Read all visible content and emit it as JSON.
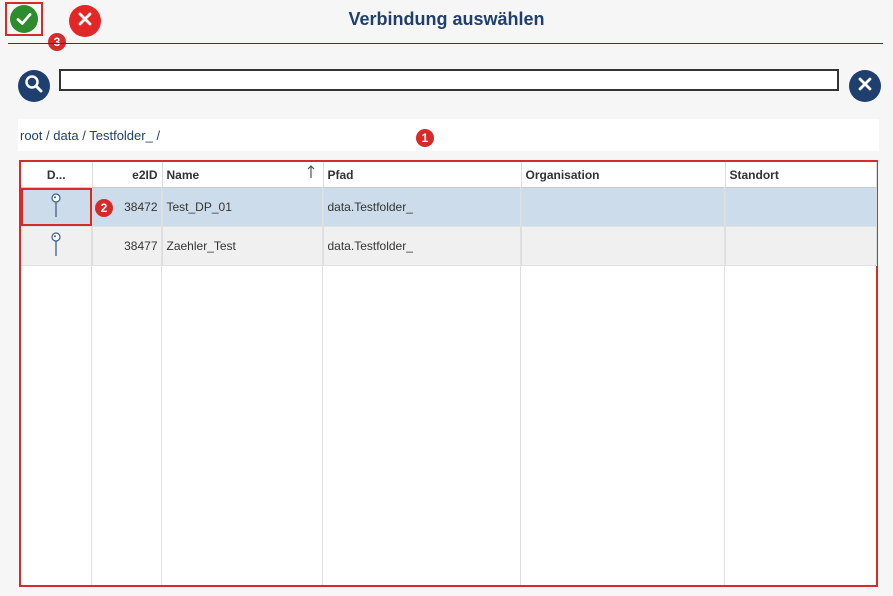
{
  "header": {
    "title": "Verbindung auswählen"
  },
  "badges": {
    "b1": "1",
    "b2": "2",
    "b3": "3"
  },
  "breadcrumb": {
    "items": [
      "root",
      "data",
      "Testfolder_"
    ],
    "separator": "/"
  },
  "search": {
    "value": "",
    "placeholder": ""
  },
  "table": {
    "columns": [
      "D...",
      "e2ID",
      "Name",
      "Pfad",
      "Organisation",
      "Standort"
    ],
    "sort_column": "Name",
    "rows": [
      {
        "e2id": "38472",
        "name": "Test_DP_01",
        "pfad": "data.Testfolder_",
        "organisation": "",
        "standort": "",
        "selected": true
      },
      {
        "e2id": "38477",
        "name": "Zaehler_Test",
        "pfad": "data.Testfolder_",
        "organisation": "",
        "standort": "",
        "selected": false
      }
    ]
  },
  "icons": {
    "ok": "checkmark-icon",
    "cancel": "close-icon",
    "search": "search-icon",
    "clear": "clear-icon",
    "row": "pin-icon"
  },
  "colors": {
    "accent": "#1f3f6e",
    "ok": "#2e8b2e",
    "cancel": "#e32727",
    "highlight": "#d62b2b",
    "selected_row": "#cddcea"
  }
}
